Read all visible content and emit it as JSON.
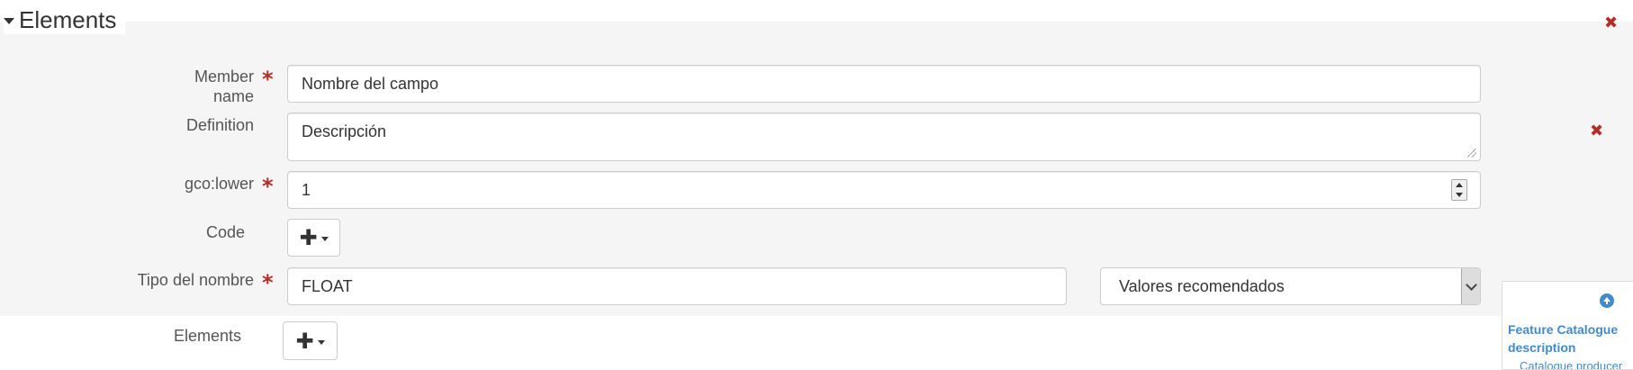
{
  "section": {
    "title": "Elements"
  },
  "fields": {
    "member_name": {
      "label": "Member name",
      "required": "*",
      "value": "Nombre del campo"
    },
    "definition": {
      "label": "Definition",
      "value": "Descripción"
    },
    "gco_lower": {
      "label": "gco:lower",
      "required": "*",
      "value": "1"
    },
    "code": {
      "label": "Code",
      "add": "✚"
    },
    "tipo_nombre": {
      "label": "Tipo del nombre",
      "required": "*",
      "value": "FLOAT",
      "select_value": "Valores recomendados"
    }
  },
  "elements_row": {
    "label": "Elements",
    "add": "✚"
  },
  "remove_icons": {
    "glyph": "✖"
  },
  "side_panel": {
    "link_title_line1": "Feature Catalogue",
    "link_title_line2": "description",
    "link_sub": "Catalogue producer"
  },
  "colors": {
    "required": "#b52b27",
    "link": "#428bca",
    "fieldset_bg": "#f5f5f5"
  }
}
